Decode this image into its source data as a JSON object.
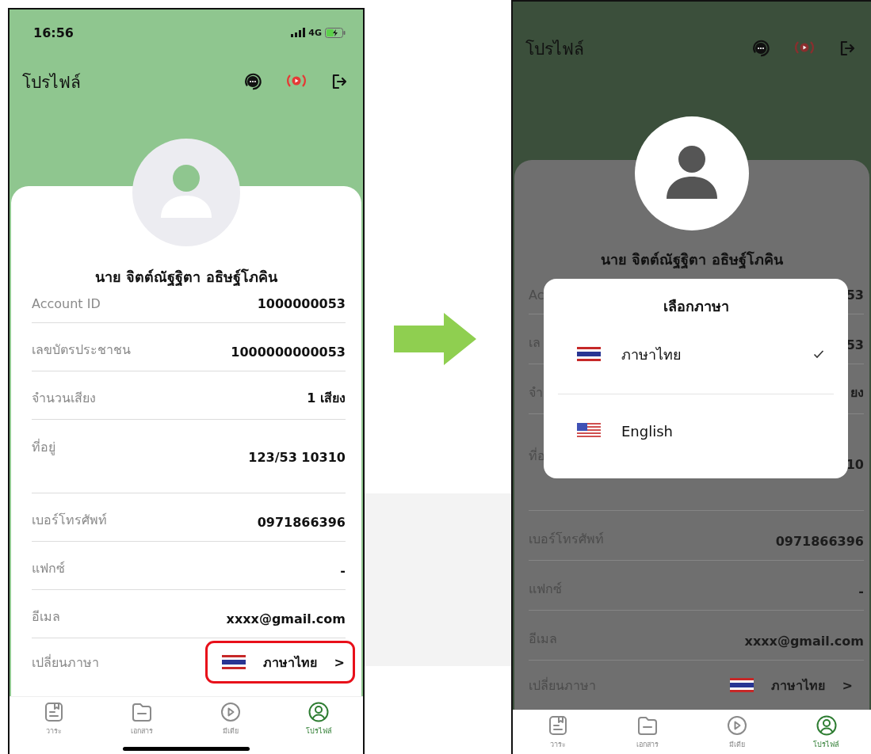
{
  "screens": [
    {
      "kind": "normal",
      "status_bar": {
        "time": "16:56",
        "network": "4G"
      },
      "header": {
        "title": "โปรไฟล์"
      },
      "profile_name": "นาย จิตต์ณัฐฐิตา อธิษฐ์โภคิน",
      "fields": [
        {
          "kind": "single",
          "label": "Account ID",
          "value": "1000000053"
        },
        {
          "kind": "single",
          "label": "เลขบัตรประชาชน",
          "value": "1000000000053"
        },
        {
          "kind": "single",
          "label": "จำนวนเสียง",
          "value": "1 เสียง"
        },
        {
          "kind": "address",
          "label": "ที่อยู่",
          "value": "123/53 10310"
        },
        {
          "kind": "single",
          "label": "เบอร์โทรศัพท์",
          "value": "0971866396"
        },
        {
          "kind": "single",
          "label": "แฟกซ์",
          "value": "-"
        },
        {
          "kind": "single",
          "label": "อีเมล",
          "value": "xxxx@gmail.com"
        }
      ],
      "language_row": {
        "label": "เปลี่ยนภาษา",
        "kind": "th",
        "value": "ภาษาไทย",
        "chevron": ">",
        "highlighted": true
      },
      "tab_bar": [
        {
          "kind": "agenda",
          "label": "วาระ",
          "selected": false
        },
        {
          "kind": "folder",
          "label": "เอกสาร",
          "selected": false
        },
        {
          "kind": "media",
          "label": "มีเดีย",
          "selected": false
        },
        {
          "kind": "profile",
          "label": "โปรไฟล์",
          "selected": true
        }
      ]
    },
    {
      "kind": "dimmed",
      "header": {
        "title": "โปรไฟล์"
      },
      "profile_name": "นาย จิตต์ณัฐฐิตา อธิษฐ์โภคิน",
      "fields": [
        {
          "kind": "single",
          "label": "Ac",
          "value": "53"
        },
        {
          "kind": "single",
          "label": "เล",
          "value": "53"
        },
        {
          "kind": "single",
          "label": "จำ",
          "value": "ยง"
        },
        {
          "kind": "address",
          "label": "ที่อ",
          "value": "10"
        },
        {
          "kind": "single",
          "label": "เบอร์โทรศัพท์",
          "value": "0971866396"
        },
        {
          "kind": "single",
          "label": "แฟกซ์",
          "value": "-"
        },
        {
          "kind": "single",
          "label": "อีเมล",
          "value": "xxxx@gmail.com"
        }
      ],
      "language_row": {
        "label": "เปลี่ยนภาษา",
        "kind": "th",
        "value": "ภาษาไทย",
        "chevron": ">",
        "highlighted": false
      },
      "tab_bar": [
        {
          "kind": "agenda",
          "label": "วาระ",
          "selected": false
        },
        {
          "kind": "folder",
          "label": "เอกสาร",
          "selected": false
        },
        {
          "kind": "media",
          "label": "มีเดีย",
          "selected": false
        },
        {
          "kind": "profile",
          "label": "โปรไฟล์",
          "selected": true
        }
      ],
      "language_dialog": {
        "title": "เลือกภาษา",
        "options": [
          {
            "kind": "th",
            "label": "ภาษาไทย",
            "selected": true
          },
          {
            "kind": "us",
            "label": "English",
            "selected": false
          }
        ]
      }
    }
  ]
}
